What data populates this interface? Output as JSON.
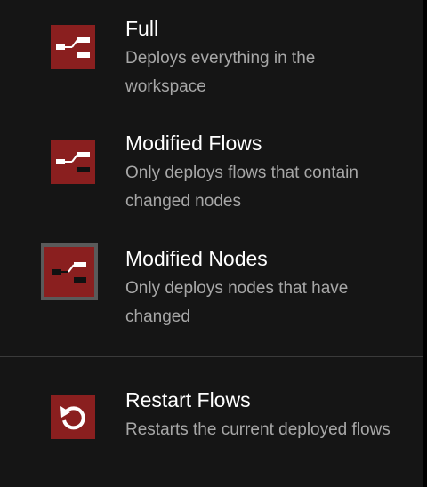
{
  "deploy_menu": {
    "items": [
      {
        "title": "Full",
        "description": "Deploys everything in the workspace",
        "icon": "deploy-full-icon"
      },
      {
        "title": "Modified Flows",
        "description": "Only deploys flows that contain changed nodes",
        "icon": "deploy-flows-icon"
      },
      {
        "title": "Modified Nodes",
        "description": "Only deploys nodes that have changed",
        "icon": "deploy-nodes-icon",
        "selected": true
      }
    ],
    "restart": {
      "title": "Restart Flows",
      "description": "Restarts the current deployed flows",
      "icon": "restart-icon"
    },
    "colors": {
      "background": "#151515",
      "icon_red": "#8a1f1f",
      "title": "#ffffff",
      "description": "#a7a7a7",
      "selected_border": "#5a5a5a"
    }
  }
}
